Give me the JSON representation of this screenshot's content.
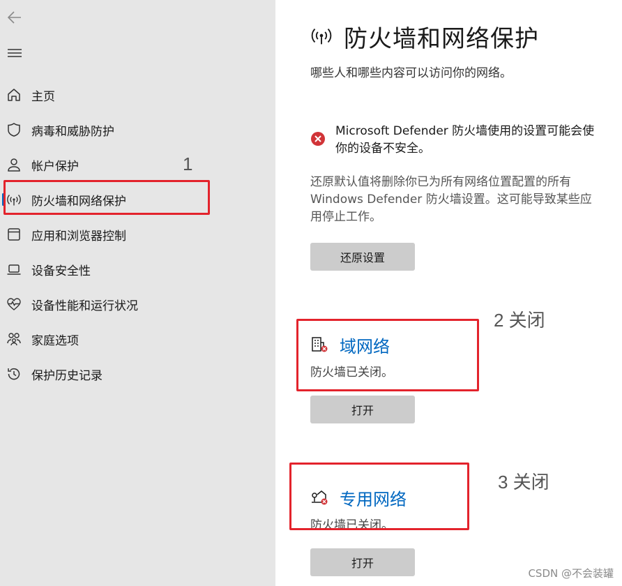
{
  "sidebar": {
    "items": [
      {
        "label": "主页",
        "icon": "home-icon"
      },
      {
        "label": "病毒和威胁防护",
        "icon": "shield-icon"
      },
      {
        "label": "帐户保护",
        "icon": "person-icon"
      },
      {
        "label": "防火墙和网络保护",
        "icon": "wifi-antenna-icon"
      },
      {
        "label": "应用和浏览器控制",
        "icon": "app-window-icon"
      },
      {
        "label": "设备安全性",
        "icon": "laptop-icon"
      },
      {
        "label": "设备性能和运行状况",
        "icon": "heart-pulse-icon"
      },
      {
        "label": "家庭选项",
        "icon": "family-icon"
      },
      {
        "label": "保护历史记录",
        "icon": "history-icon"
      }
    ],
    "active_index": 3
  },
  "main": {
    "title": "防火墙和网络保护",
    "subtitle": "哪些人和哪些内容可以访问你的网络。",
    "warning": "Microsoft Defender 防火墙使用的设置可能会使你的设备不安全。",
    "description": "还原默认值将删除你已为所有网络位置配置的所有 Windows Defender 防火墙设置。这可能导致某些应用停止工作。",
    "restore_button": "还原设置",
    "networks": [
      {
        "name": "域网络",
        "status": "防火墙已关闭。",
        "button": "打开",
        "icon": "domain-network-icon"
      },
      {
        "name": "专用网络",
        "status": "防火墙已关闭。",
        "button": "打开",
        "icon": "private-network-icon"
      }
    ]
  },
  "annotations": {
    "a1": "1",
    "a2": "2 关闭",
    "a3": "3 关闭"
  },
  "watermark": "CSDN @不会装罐",
  "colors": {
    "accent": "#0067c0",
    "error": "#d13438",
    "annotation_box": "#e3232c",
    "sidebar_bg": "#e6e6e6",
    "button_bg": "#cccccc"
  }
}
